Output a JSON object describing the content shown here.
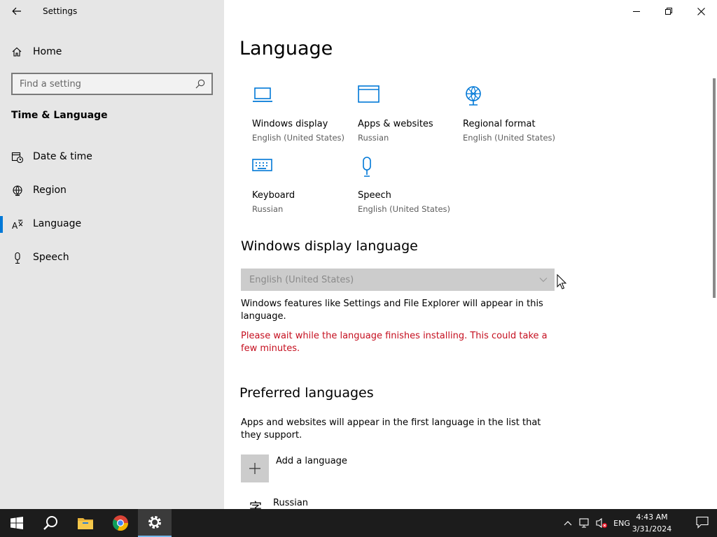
{
  "window": {
    "title": "Settings"
  },
  "sidebar": {
    "home_label": "Home",
    "search_placeholder": "Find a setting",
    "section_title": "Time & Language",
    "items": [
      {
        "label": "Date & time",
        "icon": "calendar-clock-icon"
      },
      {
        "label": "Region",
        "icon": "globe-icon"
      },
      {
        "label": "Language",
        "icon": "language-icon",
        "active": true
      },
      {
        "label": "Speech",
        "icon": "microphone-icon"
      }
    ]
  },
  "main": {
    "title": "Language",
    "tiles": [
      {
        "name": "Windows display",
        "sub": "English (United States)",
        "icon": "laptop-icon"
      },
      {
        "name": "Apps & websites",
        "sub": "Russian",
        "icon": "browser-window-icon"
      },
      {
        "name": "Regional format",
        "sub": "English (United States)",
        "icon": "globe-icon"
      },
      {
        "name": "Keyboard",
        "sub": "Russian",
        "icon": "keyboard-icon"
      },
      {
        "name": "Speech",
        "sub": "English (United States)",
        "icon": "microphone-icon"
      }
    ],
    "display_language": {
      "heading": "Windows display language",
      "selected": "English (United States)",
      "description": "Windows features like Settings and File Explorer will appear in this language.",
      "warning": "Please wait while the language finishes installing. This could take a few minutes."
    },
    "preferred": {
      "heading": "Preferred languages",
      "description": "Apps and websites will appear in the first language in the list that they support.",
      "add_label": "Add a language",
      "languages": [
        {
          "label": "Russian",
          "glyph": "字"
        }
      ]
    }
  },
  "taskbar": {
    "language_indicator": "ENG",
    "time": "4:43 AM",
    "date": "3/31/2024"
  },
  "colors": {
    "accent": "#0078d7",
    "warning": "#c50f1f",
    "sidebar_bg": "#e6e6e6",
    "taskbar_bg": "#1c1c1c"
  }
}
